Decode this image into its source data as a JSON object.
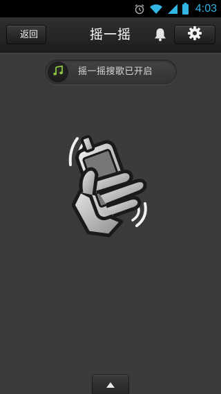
{
  "status_bar": {
    "time": "4:03",
    "icons": [
      "alarm-icon",
      "wifi-icon",
      "signal-icon",
      "battery-icon"
    ]
  },
  "header": {
    "back_label": "返回",
    "title": "摇一摇",
    "icons": [
      "bell-icon",
      "gear-icon"
    ]
  },
  "music_banner": {
    "text": "摇一摇搜歌已开启",
    "icon": "music-note-icon"
  },
  "illustration": {
    "icon": "hand-shaking-phone-icon"
  },
  "footer": {
    "icon": "triangle-up-icon"
  },
  "colors": {
    "background": "#3b3b3b",
    "titlebar": "#262626",
    "status_time": "#33b5e5",
    "music_note": "#8dc63f"
  }
}
